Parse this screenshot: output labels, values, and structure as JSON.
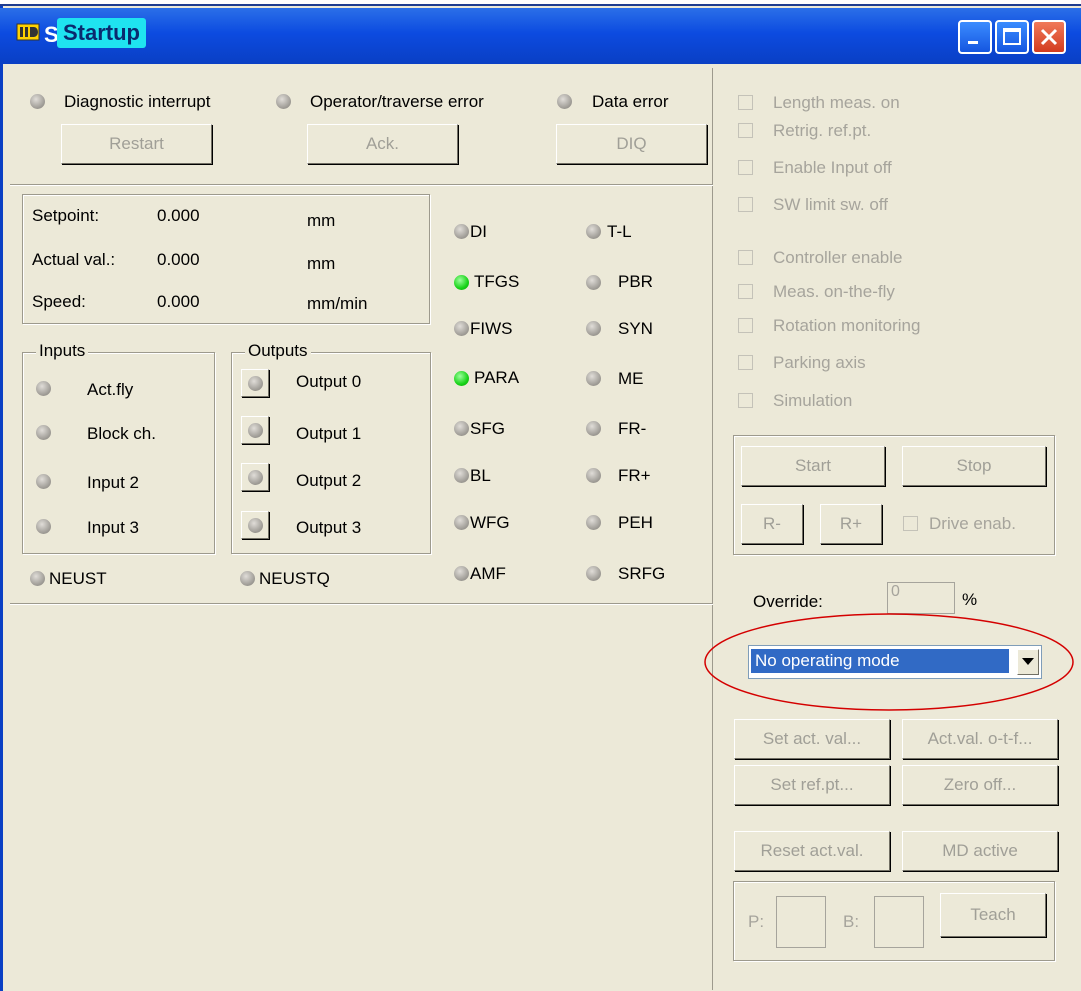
{
  "window": {
    "title_prefix": "S",
    "title": "Startup",
    "accent": "#0a3fc4",
    "highlight": "#1fe3f0"
  },
  "errors": [
    {
      "label": "Diagnostic interrupt",
      "button": "Restart"
    },
    {
      "label": "Operator/traverse error",
      "button": "Ack."
    },
    {
      "label": "Data error",
      "button": "DIQ"
    }
  ],
  "values": [
    {
      "label": "Setpoint:",
      "value": "0.000",
      "unit": "mm"
    },
    {
      "label": "Actual val.:",
      "value": "0.000",
      "unit": "mm"
    },
    {
      "label": "Speed:",
      "value": "0.000",
      "unit": "mm/min"
    }
  ],
  "inputs": {
    "title": "Inputs",
    "items": [
      "Act.fly",
      "Block ch.",
      "Input 2",
      "Input 3"
    ]
  },
  "outputs": {
    "title": "Outputs",
    "items": [
      "Output 0",
      "Output 1",
      "Output 2",
      "Output 3"
    ]
  },
  "bottom_leds": [
    "NEUST",
    "NEUSTQ"
  ],
  "status_left": [
    {
      "label": "DI",
      "on": false
    },
    {
      "label": "TFGS",
      "on": true
    },
    {
      "label": "FIWS",
      "on": false
    },
    {
      "label": "PARA",
      "on": true
    },
    {
      "label": "SFG",
      "on": false
    },
    {
      "label": "BL",
      "on": false
    },
    {
      "label": "WFG",
      "on": false
    },
    {
      "label": "AMF",
      "on": false
    }
  ],
  "status_right": [
    {
      "label": "T-L",
      "on": false
    },
    {
      "label": "PBR",
      "on": false
    },
    {
      "label": "SYN",
      "on": false
    },
    {
      "label": "ME",
      "on": false
    },
    {
      "label": "FR-",
      "on": false
    },
    {
      "label": "FR+",
      "on": false
    },
    {
      "label": "PEH",
      "on": false
    },
    {
      "label": "SRFG",
      "on": false
    }
  ],
  "checkboxes_top": [
    "Length meas. on",
    "Retrig. ref.pt.",
    "Enable Input off",
    "SW limit sw. off"
  ],
  "checkboxes_bottom": [
    "Controller enable",
    "Meas. on-the-fly",
    "Rotation monitoring",
    "Parking axis",
    "Simulation"
  ],
  "motion": {
    "start": "Start",
    "stop": "Stop",
    "r_minus": "R-",
    "r_plus": "R+",
    "drive_enable": "Drive enab."
  },
  "override": {
    "label": "Override:",
    "value": "0",
    "unit": "%"
  },
  "mode_select": {
    "selected": "No operating mode",
    "highlight_color": "#316ac5",
    "annotation_color": "#d40000"
  },
  "actions": {
    "set_act_val": "Set act. val...",
    "act_val_otf": "Act.val. o-t-f...",
    "set_ref_pt": "Set ref.pt...",
    "zero_off": "Zero off...",
    "reset_act_val": "Reset act.val.",
    "md_active": "MD active"
  },
  "teach": {
    "p_label": "P:",
    "b_label": "B:",
    "button": "Teach"
  }
}
